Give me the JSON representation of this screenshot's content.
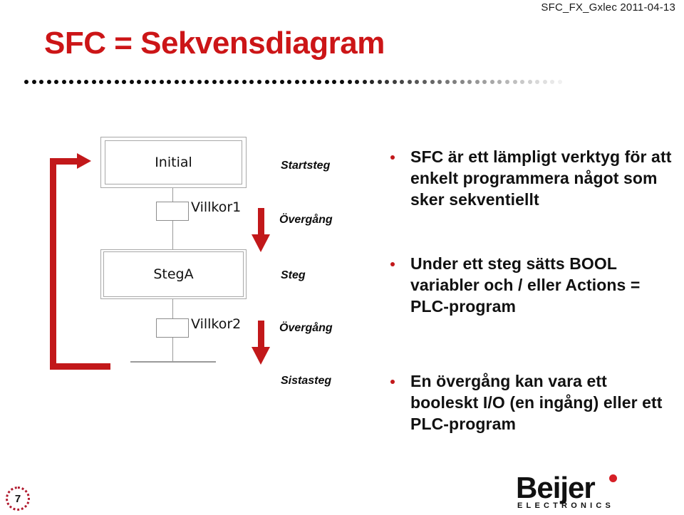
{
  "header": {
    "document_code": "SFC_FX_Gxlec  2011-04-13"
  },
  "slide": {
    "title": "SFC = Sekvensdiagram",
    "title_color": "#cc1517"
  },
  "divider": {
    "style": "dotted-fade",
    "dot_count": 72,
    "start_color": "#000000",
    "end_color": "#f0f0f0"
  },
  "diagram": {
    "accent_color": "#c2181a",
    "steps": [
      {
        "id": "initial",
        "label": "Initial",
        "type": "initial-step"
      },
      {
        "id": "stega",
        "label": "StegA",
        "type": "step"
      }
    ],
    "transitions": [
      {
        "id": "villkor1",
        "label": "Villkor1"
      },
      {
        "id": "villkor2",
        "label": "Villkor2"
      }
    ],
    "loop_arrow": "loop-back-to-initial",
    "flow_arrows": [
      "down-arrow",
      "down-arrow"
    ]
  },
  "labels": [
    {
      "text": "Startsteg"
    },
    {
      "text": "Övergång"
    },
    {
      "text": "Steg"
    },
    {
      "text": "Övergång"
    },
    {
      "text": "Sistasteg"
    }
  ],
  "bullets": [
    {
      "text": "SFC är ett lämpligt verktyg för att enkelt programmera något som sker sekventiellt"
    },
    {
      "text": "Under ett steg sätts BOOL variabler och / eller Actions = PLC-program"
    },
    {
      "text": "En övergång kan vara ett booleskt I/O (en ingång) eller ett PLC-program"
    }
  ],
  "footer": {
    "page_number": "7",
    "logo": {
      "name": "Beijer",
      "subtitle": "ELECTRONICS",
      "dot_color": "#d61f26"
    }
  }
}
